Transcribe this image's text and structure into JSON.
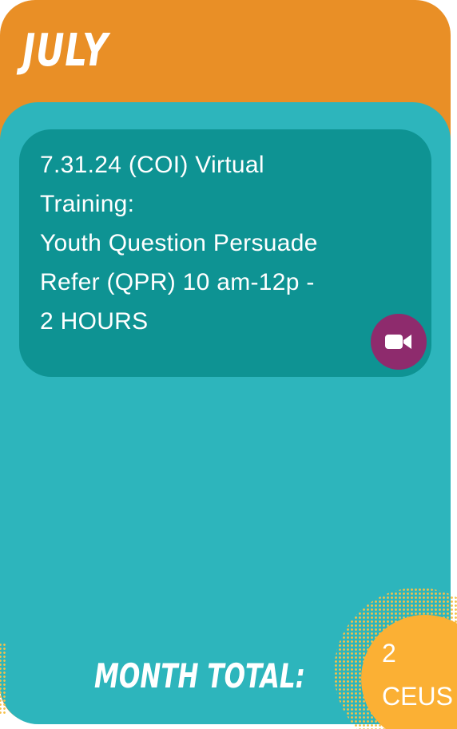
{
  "header": {
    "month": "JULY"
  },
  "event": {
    "lines": [
      "7.31.24 (COI) Virtual",
      "Training:",
      "Youth Question Persuade",
      "Refer (QPR) 10 am-12p -",
      "2 HOURS"
    ],
    "badge_icon": "video-camera-icon"
  },
  "footer": {
    "total_label": "MONTH TOTAL:",
    "ceu_value": "2",
    "ceu_unit": "CEUS"
  },
  "colors": {
    "header_orange": "#E98F26",
    "panel_teal": "#2DB5BC",
    "event_teal": "#0E9393",
    "badge_purple": "#8E2B6D",
    "ceu_yellow": "#FBB034",
    "dots_yellow": "#F6C04A"
  }
}
